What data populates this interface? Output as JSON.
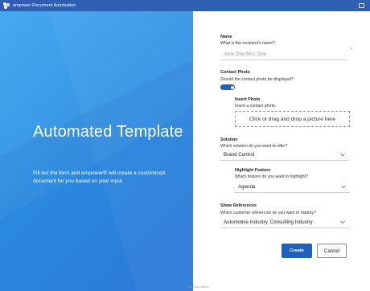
{
  "window": {
    "title": "empower Document Automation",
    "icons": [
      "app-logo-icon",
      "restore-window-icon"
    ]
  },
  "hero": {
    "title": "Automated Template",
    "subtitle": "Fill out the form and empower® will create a customized document for you based on your input."
  },
  "form": {
    "name": {
      "label": "Name",
      "hint": "What is the recipient's name?",
      "placeholder": "Jane Doe/Mrs. Doe",
      "required_mark": "*"
    },
    "contact_photo": {
      "label": "Contact Photo",
      "hint": "Should the contact photo be displayed?",
      "toggle_on": true
    },
    "insert_photo": {
      "label": "Insert Photo",
      "hint": "Insert a contact photo.",
      "dropzone_text": "Click or drag and drop a picture here"
    },
    "solution": {
      "label": "Solution",
      "hint": "Which solution do you want to offer?",
      "value": "Brand Control"
    },
    "highlight_feature": {
      "label": "Highlight Feature",
      "hint": "Which feature do you want to highlight?",
      "value": "Agenda"
    },
    "show_references": {
      "label": "Show References",
      "hint": "Which customer references do you want to display?",
      "value": "Automotive Industry, Consulting Industry"
    },
    "create_button": "Create",
    "cancel_button": "Cancel"
  },
  "footer": {
    "third_party": "Third Party Notice"
  },
  "colors": {
    "titlebar": "#2f5fb3",
    "panel_blue": "#2d8fe4",
    "accent": "#1f5fbf"
  }
}
